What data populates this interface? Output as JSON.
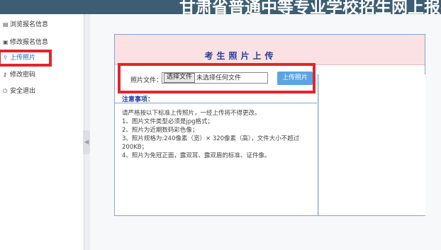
{
  "header": {
    "title": "甘肃省普通中等专业学校招生网上报名系"
  },
  "sidebar": {
    "items": [
      {
        "label": "浏览报名信息",
        "icon": "list-icon",
        "glyph": "▤"
      },
      {
        "label": "修改报名信息",
        "icon": "edit-icon",
        "glyph": "▣"
      },
      {
        "label": "上传照片",
        "icon": "upload-icon",
        "glyph": "⇪"
      },
      {
        "label": "修改密码",
        "icon": "key-icon",
        "glyph": "⚷"
      },
      {
        "label": "安全退出",
        "icon": "power-icon",
        "glyph": "⏻"
      }
    ],
    "active_index": 2,
    "collapse_glyph": "◀"
  },
  "panel": {
    "title": "考生照片上传",
    "file_label": "照片文件：",
    "choose_button": "选择文件",
    "no_file_text": "未选择任何文件",
    "upload_button": "上传照片",
    "notes_title": "注意事项：",
    "notes": [
      "请严格按以下标准上传照片，一经上传将不得更改。",
      "1、图片文件类型必须是jpg格式；",
      "2、照片为近期数码彩色像；",
      "3、照片规格为:240像素（宽）× 320像素（高），文件大小不超过",
      "200KB；",
      "4、照片为免冠正面，露双耳、露双眉的标准、证件像。"
    ]
  },
  "colors": {
    "header_bg": "#3e5d73",
    "highlight_red": "#e0262d",
    "panel_head_bg": "#fbe1e3",
    "title_blue": "#233e99",
    "upload_button_bg": "#5aa4e4"
  }
}
